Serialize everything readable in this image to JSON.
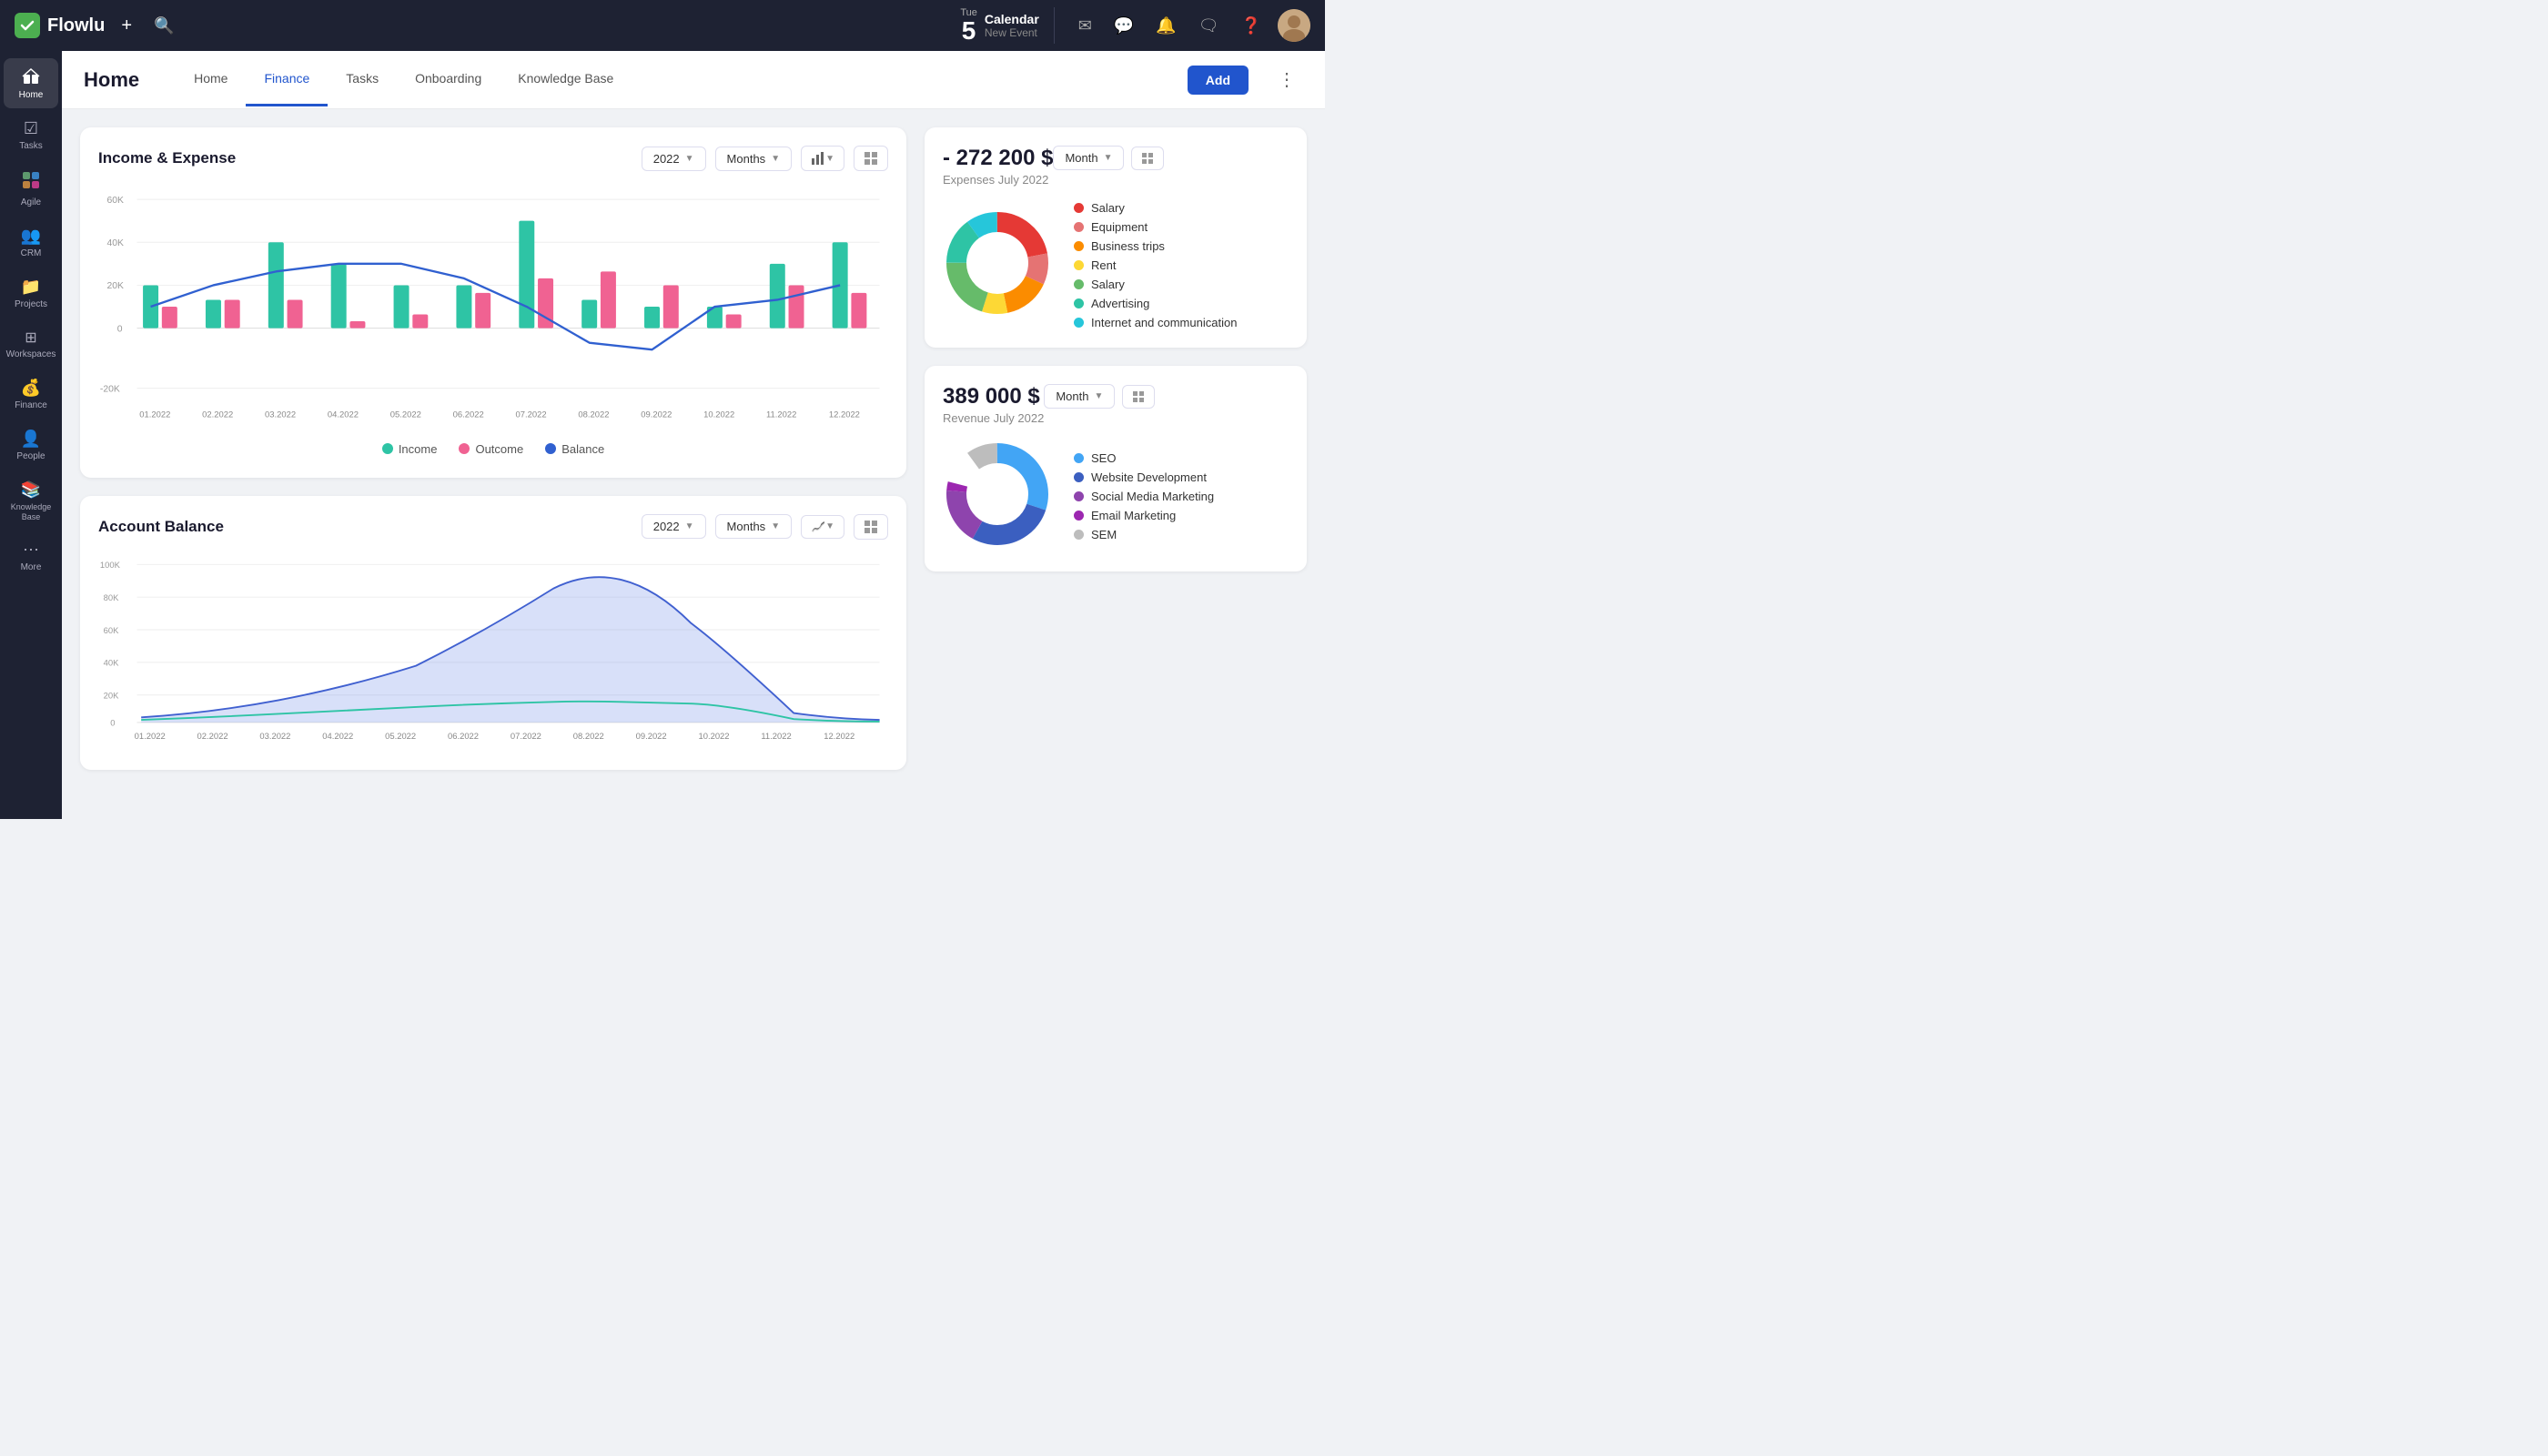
{
  "app": {
    "logo_text": "Flowlu",
    "calendar": {
      "day": "Tue",
      "date": "5",
      "title": "Calendar",
      "subtitle": "New Event"
    }
  },
  "sidebar": {
    "items": [
      {
        "id": "home",
        "label": "Home",
        "icon": "🏠",
        "active": true
      },
      {
        "id": "tasks",
        "label": "Tasks",
        "icon": "✓",
        "active": false
      },
      {
        "id": "agile",
        "label": "Agile",
        "icon": "⬡",
        "active": false
      },
      {
        "id": "crm",
        "label": "CRM",
        "icon": "👥",
        "active": false
      },
      {
        "id": "projects",
        "label": "Projects",
        "icon": "📁",
        "active": false
      },
      {
        "id": "workspaces",
        "label": "Workspaces",
        "icon": "⊞",
        "active": false
      },
      {
        "id": "finance",
        "label": "Finance",
        "icon": "💰",
        "active": false
      },
      {
        "id": "people",
        "label": "People",
        "icon": "👤",
        "active": false
      },
      {
        "id": "knowledge",
        "label": "Knowledge Base",
        "icon": "📚",
        "active": false
      },
      {
        "id": "more",
        "label": "More",
        "icon": "⋯",
        "active": false
      }
    ]
  },
  "header": {
    "page_title": "Home",
    "tabs": [
      {
        "id": "home",
        "label": "Home",
        "active": false
      },
      {
        "id": "finance",
        "label": "Finance",
        "active": true
      },
      {
        "id": "tasks",
        "label": "Tasks",
        "active": false
      },
      {
        "id": "onboarding",
        "label": "Onboarding",
        "active": false
      },
      {
        "id": "knowledge",
        "label": "Knowledge Base",
        "active": false
      }
    ],
    "add_btn": "Add"
  },
  "income_expense": {
    "title": "Income & Expense",
    "year": "2022",
    "period": "Months",
    "legend": [
      {
        "label": "Income",
        "color": "#2ec4a5"
      },
      {
        "label": "Outcome",
        "color": "#f06292"
      },
      {
        "label": "Balance",
        "color": "#3060d0"
      }
    ],
    "months": [
      "01.2022",
      "02.2022",
      "03.2022",
      "04.2022",
      "05.2022",
      "06.2022",
      "07.2022",
      "08.2022",
      "09.2022",
      "10.2022",
      "11.2022",
      "12.2022"
    ],
    "y_labels": [
      "60K",
      "40K",
      "20K",
      "0",
      "-20K"
    ],
    "bars_income": [
      22,
      18,
      40,
      30,
      22,
      22,
      48,
      20,
      18,
      16,
      30,
      40
    ],
    "bars_outcome": [
      10,
      12,
      16,
      4,
      6,
      18,
      26,
      28,
      22,
      10,
      22,
      20
    ],
    "balance_line": [
      12,
      18,
      26,
      34,
      32,
      20,
      8,
      -8,
      -10,
      10,
      14,
      26
    ]
  },
  "account_balance": {
    "title": "Account Balance",
    "year": "2022",
    "period": "Months",
    "months": [
      "01.2022",
      "02.2022",
      "03.2022",
      "04.2022",
      "05.2022",
      "06.2022",
      "07.2022",
      "08.2022",
      "09.2022",
      "10.2022",
      "11.2022",
      "12.2022"
    ],
    "y_labels": [
      "100K",
      "80K",
      "60K",
      "40K",
      "20K",
      "0"
    ]
  },
  "expenses_widget": {
    "amount": "- 272 200 $",
    "label": "Expenses July 2022",
    "period": "Month",
    "legend": [
      {
        "label": "Salary",
        "color": "#e53935"
      },
      {
        "label": "Equipment",
        "color": "#e57373"
      },
      {
        "label": "Business trips",
        "color": "#fb8c00"
      },
      {
        "label": "Rent",
        "color": "#fdd835"
      },
      {
        "label": "Salary",
        "color": "#66bb6a"
      },
      {
        "label": "Advertising",
        "color": "#2ec4a5"
      },
      {
        "label": "Internet and communication",
        "color": "#26c6da"
      }
    ],
    "donut": {
      "segments": [
        {
          "color": "#e53935",
          "pct": 22
        },
        {
          "color": "#e57373",
          "pct": 10
        },
        {
          "color": "#fb8c00",
          "pct": 15
        },
        {
          "color": "#fdd835",
          "pct": 8
        },
        {
          "color": "#66bb6a",
          "pct": 20
        },
        {
          "color": "#2ec4a5",
          "pct": 15
        },
        {
          "color": "#26c6da",
          "pct": 10
        }
      ]
    }
  },
  "revenue_widget": {
    "amount": "389 000 $",
    "label": "Revenue July 2022",
    "period": "Month",
    "legend": [
      {
        "label": "SEO",
        "color": "#42a5f5"
      },
      {
        "label": "Website Development",
        "color": "#3b5fc0"
      },
      {
        "label": "Social Media Marketing",
        "color": "#8e44ad"
      },
      {
        "label": "Email Marketing",
        "color": "#9c27b0"
      },
      {
        "label": "SEM",
        "color": "#bdbdbd"
      }
    ],
    "donut": {
      "segments": [
        {
          "color": "#42a5f5",
          "pct": 30
        },
        {
          "color": "#3b5fc0",
          "pct": 28
        },
        {
          "color": "#8e44ad",
          "pct": 18
        },
        {
          "color": "#9c27b0",
          "pct": 14
        },
        {
          "color": "#bdbdbd",
          "pct": 10
        }
      ]
    }
  }
}
